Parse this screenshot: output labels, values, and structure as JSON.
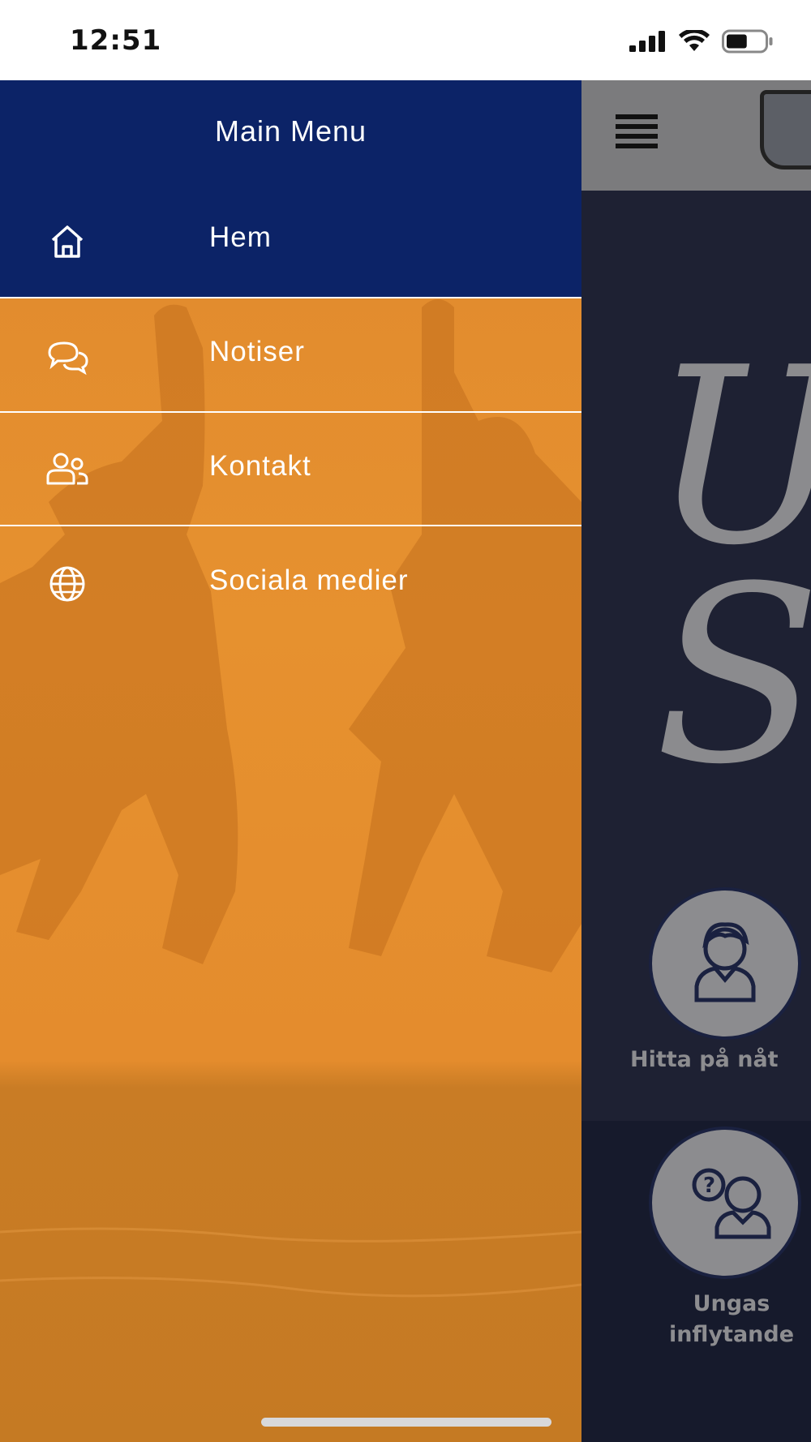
{
  "status_bar": {
    "time": "12:51",
    "battery_level": 0.55
  },
  "drawer": {
    "title": "Main Menu",
    "header_color": "#0c2367",
    "accent_color": "#e38b2e",
    "items": [
      {
        "label": "Hem",
        "icon": "home-icon",
        "active": true
      },
      {
        "label": "Notiser",
        "icon": "chat-bubbles-icon",
        "active": false
      },
      {
        "label": "Kontakt",
        "icon": "people-icon",
        "active": false
      },
      {
        "label": "Sociala medier",
        "icon": "globe-icon",
        "active": false
      }
    ]
  },
  "background_app": {
    "cards": [
      {
        "label": "Hitta på nåt",
        "icon": "person-icon"
      },
      {
        "label": "Ungas inflytande",
        "icon": "person-question-icon"
      }
    ]
  }
}
